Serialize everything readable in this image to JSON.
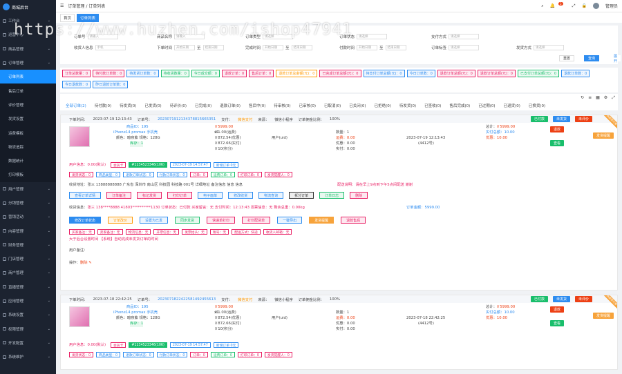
{
  "sidebar": {
    "brand": "商城后台",
    "items": [
      {
        "label": "工作台",
        "ic": "home-icon"
      },
      {
        "label": "运营中心",
        "ic": "chart-icon"
      },
      {
        "label": "商品管理",
        "ic": "box-icon"
      },
      {
        "label": "订单管理",
        "ic": "order-icon"
      },
      {
        "label": "订单列表",
        "sub": true,
        "active": true
      },
      {
        "label": "售后订单",
        "sub": true
      },
      {
        "label": "评价管理",
        "sub": true
      },
      {
        "label": "发货设置",
        "sub": true
      },
      {
        "label": "运费模板",
        "sub": true
      },
      {
        "label": "物流追踪",
        "sub": true
      },
      {
        "label": "数据统计",
        "sub": true
      },
      {
        "label": "打印模板",
        "sub": true
      },
      {
        "label": "用户管理",
        "ic": "user-icon"
      },
      {
        "label": "分销管理",
        "ic": "share-icon"
      },
      {
        "label": "营销活动",
        "ic": "gift-icon"
      },
      {
        "label": "内容管理",
        "ic": "doc-icon"
      },
      {
        "label": "财务管理",
        "ic": "money-icon"
      },
      {
        "label": "门店管理",
        "ic": "store-icon"
      },
      {
        "label": "商户管理",
        "ic": "shop-icon"
      },
      {
        "label": "直播管理",
        "ic": "video-icon"
      },
      {
        "label": "应用管理",
        "ic": "app-icon"
      },
      {
        "label": "系统设置",
        "ic": "gear-icon"
      },
      {
        "label": "权限管理",
        "ic": "lock-icon"
      },
      {
        "label": "开发配置",
        "ic": "code-icon"
      },
      {
        "label": "系统维护",
        "ic": "tool-icon"
      }
    ]
  },
  "topbar": {
    "breadcrumb1": "订单管理",
    "sep": "/",
    "breadcrumb2": "订单列表",
    "badge": "2",
    "user": "管理员"
  },
  "tabs": [
    "首页",
    "订单列表"
  ],
  "watermark": "https://www.huzhen.com/ishop47941",
  "filter": {
    "r1": [
      {
        "label": "订单号",
        "ph": "请输入"
      },
      {
        "label": "商品名称",
        "ph": "请输入"
      },
      {
        "label": "订单类型",
        "ph": "请选择"
      },
      {
        "label": "订单状态",
        "ph": "请选择"
      },
      {
        "label": "支付方式",
        "ph": "请选择"
      }
    ],
    "r2": [
      {
        "label": "收货人信息",
        "ph": "手机"
      },
      {
        "label": "下单时间",
        "ph": "开始日期"
      },
      {
        "label": "完成时间",
        "ph": "开始日期"
      },
      {
        "label": "付款时间",
        "ph": "开始日期"
      },
      {
        "label": "订单标签",
        "ph": "请选择"
      },
      {
        "label": "发货方式",
        "ph": "请选择"
      }
    ],
    "to": "至",
    "end": "结束日期",
    "reset": "重置",
    "search": "查询",
    "expand": "展开"
  },
  "stats": [
    {
      "t": "订单总数量：0",
      "c": "#e91e63"
    },
    {
      "t": "待付款订单数：0",
      "c": "#e91e63"
    },
    {
      "t": "待发货订单数：0",
      "c": "#2d8cf0"
    },
    {
      "t": "待收货数量：0",
      "c": "#19be6b"
    },
    {
      "t": "今日成交额：0",
      "c": "#19be6b"
    },
    {
      "t": "退款订单：0",
      "c": "#e91e63"
    },
    {
      "t": "售后订单：0",
      "c": "#e91e63"
    },
    {
      "t": "退款订单总金额(元)：0",
      "c": "#f90"
    },
    {
      "t": "已完成订单总额(元)：0",
      "c": "#e91e63"
    },
    {
      "t": "待支付订单总额(元)：0",
      "c": "#2d8cf0"
    },
    {
      "t": "今日订单数：0",
      "c": "#2d8cf0"
    },
    {
      "t": "退款订单总额(元)：0",
      "c": "#e91e63"
    },
    {
      "t": "退款订单总额(元)：0",
      "c": "#e91e63"
    },
    {
      "t": "已支付订单总额(元)：0",
      "c": "#19be6b"
    },
    {
      "t": "退款订单数：0",
      "c": "#2d8cf0"
    },
    {
      "t": "今日退款数：0",
      "c": "#2d8cf0"
    },
    {
      "t": "昨日退款订单数：0",
      "c": "#2d8cf0"
    }
  ],
  "otabs": [
    {
      "t": "全部订单(2)",
      "on": true
    },
    {
      "t": "待付款(0)"
    },
    {
      "t": "待发货(0)"
    },
    {
      "t": "已发货(0)"
    },
    {
      "t": "待评价(0)"
    },
    {
      "t": "已完成(0)"
    },
    {
      "t": "退款订单(0)"
    },
    {
      "t": "售后中(0)"
    },
    {
      "t": "待审核(0)"
    },
    {
      "t": "已审核(0)"
    },
    {
      "t": "已取消(0)"
    },
    {
      "t": "已关闭(0)"
    },
    {
      "t": "已拒绝(0)"
    },
    {
      "t": "待发货(0)"
    },
    {
      "t": "已签收(0)"
    },
    {
      "t": "售后完成(0)"
    },
    {
      "t": "已过期(0)"
    },
    {
      "t": "已退货(0)"
    },
    {
      "t": "已换货(0)"
    }
  ],
  "orders": [
    {
      "label": "下单时间：",
      "time": "2023-07-19 12:13:43",
      "no_label": "订单号：",
      "no": "2023071912134378815665351",
      "pay_label": "支付：",
      "pay": "微信支付",
      "src_label": "来源：",
      "src": "微信小程序",
      "mode_label": "订单佣金比例：",
      "mode": "100%",
      "tags": [
        "已付款",
        "未发货",
        "未评价"
      ],
      "pid": "商品ID：195",
      "pname": "iPhone14 promax 手机壳",
      "spec": "颜色：暗夜紫 规格：128G",
      "stock": "库存：1",
      "price": "￥5999.00",
      "qty": "x1",
      "p1": "￥1.00(运费)",
      "p2": "￥872.54(优惠)",
      "p3": "￥872.66(实付)",
      "p4": "￥10(积分)",
      "buyer": "用户(uid)",
      "cnt": "数量：1",
      "c1": "运费：0.00",
      "c2": "优惠：0.00",
      "c3": "实付：0.00",
      "date": "2023-07-19 12:13:43",
      "uid": "(4412号)",
      "sum_l": "总计：",
      "sum": "￥5999.00",
      "paid": "实付总额：10.00",
      "disc": "优惠：10.00",
      "rb": [
        "退款",
        "查看"
      ],
      "ribbon": "待发货订单"
    },
    {
      "label": "下单时间：",
      "time": "2023-07-18 22:42:25",
      "no_label": "订单号：",
      "no": "2023071822422581492455613",
      "pay_label": "支付：",
      "pay": "微信支付",
      "src_label": "来源：",
      "src": "微信小程序",
      "mode_label": "订单佣金比例：",
      "mode": "100%",
      "tags": [
        "已付款",
        "未发货",
        "未评价"
      ],
      "pid": "商品ID：195",
      "pname": "iPhone14 promax 手机壳",
      "spec": "颜色：暗夜紫 规格：128G",
      "stock": "库存：1",
      "price": "￥5999.00",
      "qty": "x1",
      "p1": "￥1.00(运费)",
      "p2": "￥872.54(优惠)",
      "p3": "￥872.66(实付)",
      "p4": "￥10(积分)",
      "buyer": "用户(uid)",
      "cnt": "数量：1",
      "c1": "运费：0.00",
      "c2": "优惠：0.00",
      "c3": "实付：0.00",
      "date": "2023-07-18 22:42:25",
      "uid": "(4412号)",
      "sum_l": "总计：",
      "sum": "￥5999.00",
      "paid": "实付总额：10.00",
      "disc": "优惠：10.00",
      "rb": [
        "退款",
        "查看"
      ],
      "ribbon": "待发货订单"
    }
  ],
  "o1": {
    "ctag": [
      "查看详情",
      "新增商品"
    ],
    "rowA_label": "用户信息：0.00(默认)",
    "rowA": [
      {
        "t": "会员卡",
        "c": "#e91e63"
      },
      {
        "t": "#1234523346(106)",
        "c": "#fff",
        "bg": "#19be6b"
      },
      {
        "t": "2023-07-19 14:57:47",
        "c": "#2d8cf0"
      },
      {
        "t": "新增订单 0元",
        "c": "#2d8cf0"
      }
    ],
    "rowB": [
      {
        "t": "发货状态：0",
        "c": "#e91e63"
      },
      {
        "t": "商品类型：0",
        "c": "#2d8cf0"
      },
      {
        "t": "退款订单状态：0",
        "c": "#2d8cf0"
      },
      {
        "t": "付款订单状态：0",
        "c": "#2d8cf0"
      },
      {
        "t": "订单：0",
        "c": "#e91e63"
      },
      {
        "t": "运费订单：0",
        "c": "#19be6b"
      },
      {
        "t": "打印订单：0",
        "c": "#e91e63"
      },
      {
        "t": "发货提醒人：0",
        "c": "#e91e63"
      }
    ],
    "addr": "收货地址：张三 13888888888 广东省 深圳市 南山区 科技园 科技路 001号 详细地址 备注信息 信息 信息",
    "memo": "配送说明：请在早上9点到下午5点间配送 谢谢",
    "actions1": [
      {
        "t": "查看订单详情",
        "c": "#2d8cf0",
        "bg": "#eaf4fe"
      },
      {
        "t": "订单备注",
        "c": "#e91e63",
        "bg": "#fde8f0"
      },
      {
        "t": "标记发货",
        "c": "#e91e63",
        "bg": "#fde8f0"
      },
      {
        "t": "打印订单",
        "c": "#e91e63",
        "bg": "#fde8f0"
      },
      {
        "t": "电子面单",
        "c": "#2d8cf0",
        "bg": "#eaf4fe"
      },
      {
        "t": "修改收货",
        "c": "#2d8cf0",
        "bg": "#eaf4fe"
      },
      {
        "t": "物流查询",
        "c": "#2d8cf0",
        "bg": "#eaf4fe"
      },
      {
        "t": "拆分订单",
        "c": "#333",
        "bg": "#eee"
      },
      {
        "t": "订单日志",
        "c": "#19be6b",
        "bg": "#e8f8ef"
      },
      {
        "t": "删除",
        "c": "#e91e63",
        "bg": "#fde8f0"
      }
    ],
    "rec_l": "收货信息：",
    "rec": "张三 138****8888 41803**********1130 订单状态：已付款 买家留言：无 支付时间：12:13:43 发票信息：无 剩余总重：0.00kg",
    "rec2": "订单金额：5999.00",
    "actions2": [
      {
        "t": "修改订单状态",
        "c": "#fff",
        "bg": "#2d8cf0"
      },
      {
        "t": "订单改价",
        "c": "#f90",
        "bg": "#fff5e6"
      },
      {
        "t": "设置为已发",
        "c": "#2d8cf0",
        "bg": "#eaf4fe"
      },
      {
        "t": "同步发货",
        "c": "#19be6b",
        "bg": "#e8f8ef"
      },
      {
        "t": "快递单打印",
        "c": "#e91e63",
        "bg": "#fde8f0"
      },
      {
        "t": "打印配货单",
        "c": "#e91e63",
        "bg": "#fde8f0"
      },
      {
        "t": "一键导出",
        "c": "#2d8cf0",
        "bg": "#eaf4fe"
      },
      {
        "t": "发货提醒",
        "c": "#fff",
        "bg": "#f7a33b"
      },
      {
        "t": "退款售后",
        "c": "#e91e63",
        "bg": "#fde8f0"
      }
    ],
    "rowC": [
      {
        "t": "买家备注：无"
      },
      {
        "t": "卖家备注：无"
      },
      {
        "t": "物流信息：无"
      },
      {
        "t": "开票信息：无"
      },
      {
        "t": "发票抬头：无"
      },
      {
        "t": "税号：无"
      },
      {
        "t": "配送方式：快递"
      },
      {
        "t": "收货人邮箱：无"
      }
    ],
    "note": "大于后台设置时间 【系统】自动完成未发货订单的时间",
    "note2": "用户备注：",
    "opl": "操作：",
    "op": "删除"
  },
  "o2": {
    "ctag": [
      "查看详情",
      "新增商品"
    ],
    "rowA_label": "用户信息：0.00(默认)",
    "rowA": [
      {
        "t": "会员卡",
        "c": "#e91e63"
      },
      {
        "t": "#1234523346(106)",
        "c": "#fff",
        "bg": "#19be6b"
      },
      {
        "t": "2023-07-19 14:57:47",
        "c": "#2d8cf0"
      },
      {
        "t": "新增订单 0元",
        "c": "#2d8cf0"
      }
    ],
    "rowB": [
      {
        "t": "发货状态：0",
        "c": "#e91e63"
      },
      {
        "t": "商品类型：0",
        "c": "#2d8cf0"
      },
      {
        "t": "退款订单状态：0",
        "c": "#2d8cf0"
      },
      {
        "t": "付款订单状态：0",
        "c": "#2d8cf0"
      },
      {
        "t": "订单：0",
        "c": "#e91e63"
      },
      {
        "t": "运费订单：0",
        "c": "#19be6b"
      },
      {
        "t": "打印订单：0",
        "c": "#e91e63"
      },
      {
        "t": "发货提醒人：0",
        "c": "#e91e63"
      }
    ]
  }
}
